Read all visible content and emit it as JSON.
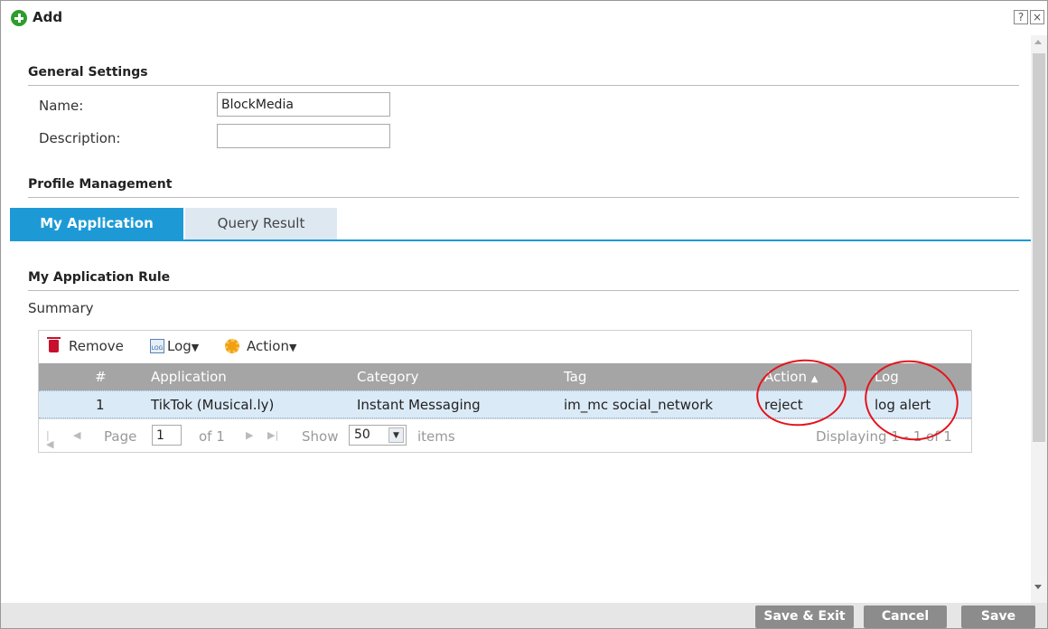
{
  "dialog": {
    "title": "Add",
    "help_glyph": "?",
    "close_glyph": "×"
  },
  "general": {
    "section_title": "General Settings",
    "name_label": "Name:",
    "name_value": "BlockMedia",
    "description_label": "Description:",
    "description_value": ""
  },
  "profile": {
    "section_title": "Profile Management",
    "tabs": [
      {
        "label": "My Application",
        "active": true
      },
      {
        "label": "Query Result",
        "active": false
      }
    ]
  },
  "rule": {
    "section_title": "My Application Rule",
    "summary_label": "Summary",
    "toolbar": {
      "remove_label": "Remove",
      "log_label": "Log",
      "action_label": "Action",
      "caret": "▼"
    },
    "columns": [
      "#",
      "Application",
      "Category",
      "Tag",
      "Action",
      "Log"
    ],
    "sort_indicator": "▲",
    "rows": [
      {
        "index": "1",
        "application": "TikTok (Musical.ly)",
        "category": "Instant Messaging",
        "tag": "im_mc social_network",
        "action": "reject",
        "log": "log alert"
      }
    ],
    "pager": {
      "page_label": "Page",
      "page_value": "1",
      "of_label": "of 1",
      "show_label": "Show",
      "show_value": "50",
      "items_label": "items",
      "displaying": "Displaying 1 - 1 of 1"
    }
  },
  "footer": {
    "save_exit_label": "Save & Exit",
    "cancel_label": "Cancel",
    "save_label": "Save"
  },
  "colors": {
    "accent": "#1d9ad6",
    "header_bg": "#a5a5a5",
    "selected_row": "#dbeaf7",
    "annotation": "#e3141d",
    "button_bg": "#8c8c8c"
  }
}
